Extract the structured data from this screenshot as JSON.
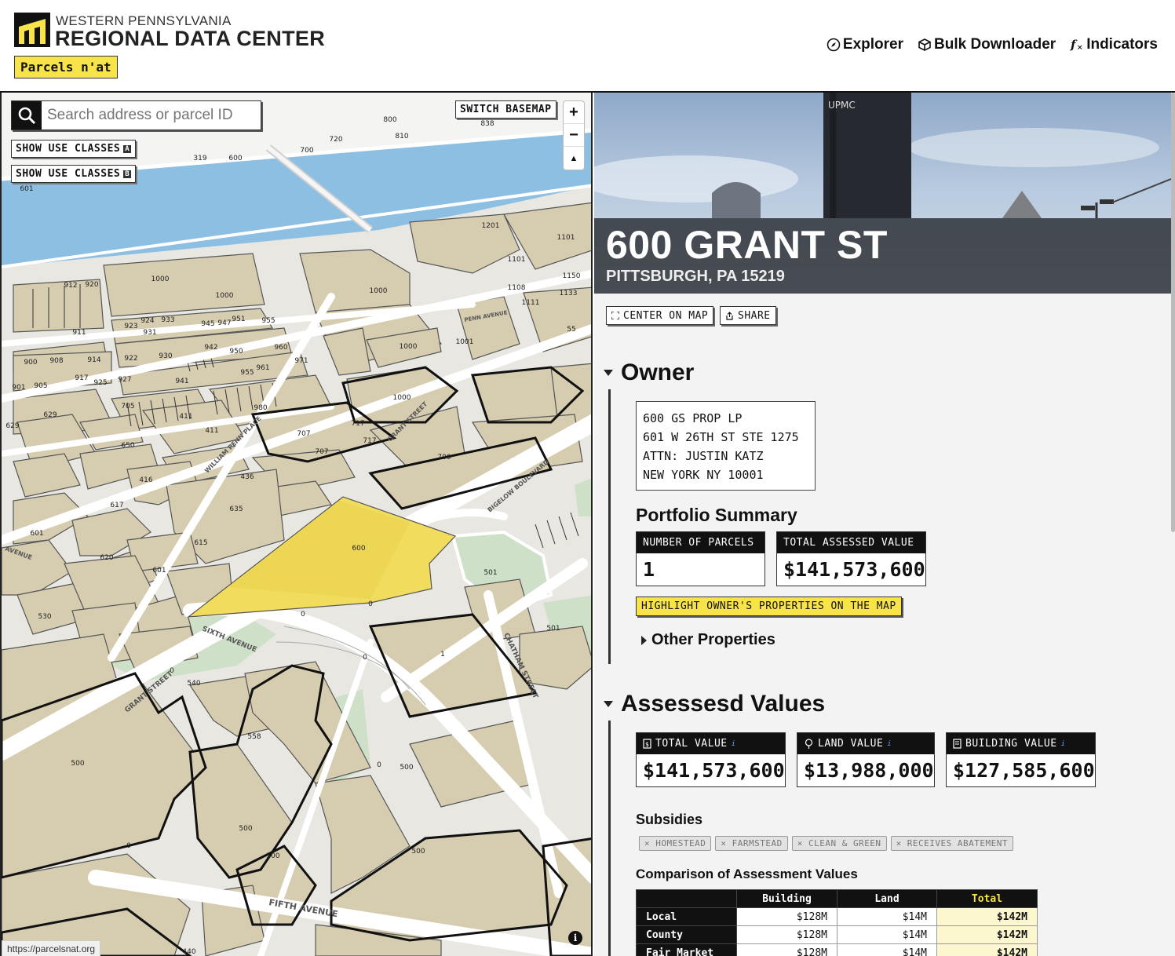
{
  "header": {
    "org_line1": "WESTERN PENNSYLVANIA",
    "org_line2": "REGIONAL DATA CENTER",
    "app_name": "Parcels n'at",
    "nav": [
      {
        "label": "Explorer",
        "icon": "compass-icon"
      },
      {
        "label": "Bulk Downloader",
        "icon": "package-icon"
      },
      {
        "label": "Indicators",
        "icon": "function-icon"
      }
    ]
  },
  "map": {
    "search_placeholder": "Search address or parcel ID",
    "switch_basemap": "SWITCH BASEMAP",
    "use_classes_1": "SHOW USE CLASSES",
    "use_classes_1_key": "A",
    "use_classes_2": "SHOW USE CLASSES",
    "use_classes_2_key": "B",
    "zoom_in": "+",
    "zoom_out": "−",
    "compass": "▲",
    "status_url": "https://parcelsnat.org",
    "info": "i",
    "street_labels": {
      "grant": "GRANT STREET",
      "sixth": "SIXTH AVENUE",
      "fifth": "FIFTH AVENUE",
      "chatham": "CHATHAM STREET",
      "bigelow": "BIGELOW BOULEVARD",
      "william_penn": "WILLIAM PENN PLACE",
      "grant2": "GRANT STREET",
      "penn": "PENN AVENUE",
      "avenue": "AVENUE"
    },
    "parcel_numbers": {
      "p600": "600",
      "p0a": "0",
      "p1": "1",
      "p501a": "501",
      "p501b": "501",
      "p530": "530",
      "p540": "540",
      "p558": "558",
      "p500a": "500",
      "p500b": "500",
      "p500c": "500",
      "p500d": "500",
      "p500e": "500",
      "p0b": "0",
      "p0c": "0",
      "p0d": "0",
      "p0e": "0",
      "p0f": "0",
      "p440": "440",
      "p620": "620",
      "p601a": "601",
      "p615": "615",
      "p635": "635",
      "p436": "436",
      "p416": "416",
      "p617": "617",
      "p601b": "601",
      "p650": "650",
      "p700": "700",
      "p707a": "707",
      "p707b": "707",
      "p717a": "717",
      "p717b": "717",
      "p1000a": "1000",
      "p980": "980",
      "p411a": "411",
      "p411b": "411",
      "p705": "705",
      "p629a": "629",
      "p629b": "629",
      "p1000b": "1000",
      "p1000c": "1000",
      "p1000d": "1000",
      "p1000e": "1000",
      "p1001": "1001",
      "p1101a": "1101",
      "p1101b": "1101",
      "p1201": "1201",
      "p1150": "1150",
      "p1108": "1108",
      "p1111": "1111",
      "p1133": "1133",
      "p55": "55",
      "p912": "912",
      "p920": "920",
      "p911": "911",
      "p900": "900",
      "p908": "908",
      "p914": "914",
      "p925": "925",
      "p901": "901",
      "p905": "905",
      "p917": "917",
      "p922": "922",
      "p930": "930",
      "p924": "924",
      "p933": "933",
      "p931": "931",
      "p945": "945",
      "p947": "947",
      "p951": "951",
      "p955a": "955",
      "p950": "950",
      "p942": "942",
      "p960": "960",
      "p971": "971",
      "p955b": "955",
      "p961": "961",
      "p927": "927",
      "p941": "941",
      "p923": "923",
      "p700b": "700",
      "p720": "720",
      "p800": "800",
      "p810": "810",
      "p838": "838",
      "p601c": "601",
      "p319": "319",
      "p600b": "600"
    }
  },
  "property": {
    "address": "600 GRANT ST",
    "city": "PITTSBURGH, PA 15219",
    "center_btn": "CENTER ON MAP",
    "share_btn": "SHARE",
    "hero_sign": "UPMC"
  },
  "owner": {
    "heading": "Owner",
    "lines": [
      "600 GS PROP LP",
      "601 W 26TH ST STE 1275",
      "ATTN: JUSTIN KATZ",
      "NEW YORK NY 10001"
    ],
    "portfolio_heading": "Portfolio Summary",
    "parcels_label": "NUMBER OF PARCELS",
    "parcels_value": "1",
    "total_label": "TOTAL ASSESSED VALUE",
    "total_value": "$141,573,600",
    "highlight_btn": "HIGHLIGHT OWNER'S PROPERTIES ON THE MAP",
    "other_properties": "Other Properties"
  },
  "assessed": {
    "heading": "Assessesd Values",
    "total_label": "TOTAL VALUE",
    "total_value": "$141,573,600",
    "land_label": "LAND VALUE",
    "land_value": "$13,988,000",
    "building_label": "BUILDING VALUE",
    "building_value": "$127,585,600",
    "subsidies_heading": "Subsidies",
    "subsidies": [
      "× HOMESTEAD",
      "× FARMSTEAD",
      "× CLEAN & GREEN",
      "× RECEIVES ABATEMENT"
    ],
    "comparison_heading": "Comparison of Assessment Values",
    "columns": [
      "Building",
      "Land",
      "Total"
    ],
    "rows": [
      {
        "name": "Local",
        "building": "$128M",
        "land": "$14M",
        "total": "$142M"
      },
      {
        "name": "County",
        "building": "$128M",
        "land": "$14M",
        "total": "$142M"
      },
      {
        "name": "Fair Market",
        "building": "$128M",
        "land": "$14M",
        "total": "$142M"
      }
    ]
  },
  "colors": {
    "accent_yellow": "#f7e34a",
    "parcel_fill": "#d6ccb0",
    "water": "#8dbfe2",
    "park": "#cfe0c8",
    "selected_parcel": "#f2dc5d"
  }
}
